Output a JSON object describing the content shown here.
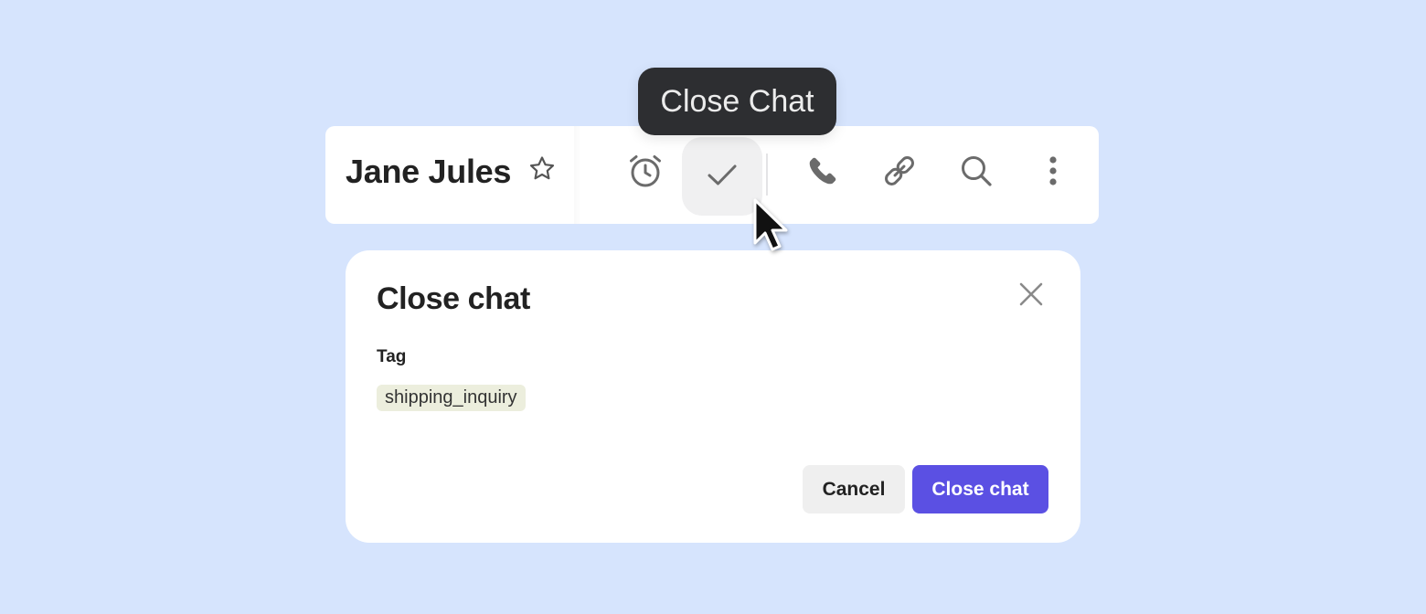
{
  "tooltip": {
    "text": "Close Chat"
  },
  "header": {
    "contact_name": "Jane Jules",
    "icons": {
      "star": "star-icon",
      "snooze": "alarm-clock-icon",
      "close_chat": "checkmark-icon",
      "call": "phone-icon",
      "link": "link-icon",
      "search": "search-icon",
      "more": "more-vertical-icon"
    },
    "active_button": "close_chat"
  },
  "dialog": {
    "title": "Close chat",
    "close_icon": "close-icon",
    "tag_label": "Tag",
    "tag_value": "shipping_inquiry",
    "cancel_label": "Cancel",
    "confirm_label": "Close chat"
  },
  "colors": {
    "background": "#d6e4fd",
    "tooltip_bg": "#2d2e31",
    "primary_button": "#5b50e3",
    "tag_chip_bg": "#eceedd",
    "icon_gray": "#6b6b6b"
  }
}
